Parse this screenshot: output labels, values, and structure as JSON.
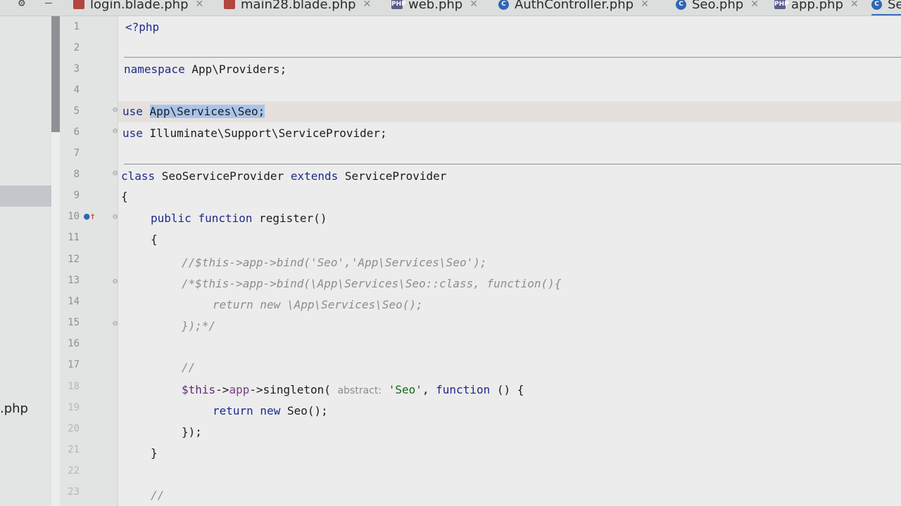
{
  "tabs": [
    {
      "label": "login.blade.php",
      "icon": "blade-file-icon"
    },
    {
      "label": "main28.blade.php",
      "icon": "blade-file-icon"
    },
    {
      "label": "web.php",
      "icon": "php-file-icon"
    },
    {
      "label": "AuthController.php",
      "icon": "class-icon"
    },
    {
      "label": "Seo.php",
      "icon": "class-icon"
    },
    {
      "label": "app.php",
      "icon": "php-file-icon"
    },
    {
      "label": "Se",
      "icon": "class-icon"
    }
  ],
  "project_panel": {
    "fragment_1": ".php"
  },
  "line_numbers": [
    "1",
    "2",
    "3",
    "4",
    "5",
    "6",
    "7",
    "8",
    "9",
    "10",
    "11",
    "12",
    "13",
    "14",
    "15",
    "16",
    "17",
    "18",
    "19",
    "20",
    "21",
    "22",
    "23"
  ],
  "code": {
    "l1_open": "<?php",
    "l3_kw": "namespace",
    "l3_rest": " App\\Providers;",
    "l5_kw": "use",
    "l5_selected": "App\\Services\\Seo;",
    "l6_kw": "use",
    "l6_rest": " Illuminate\\Support\\ServiceProvider;",
    "l8_kw": "class",
    "l8_name": " SeoServiceProvider ",
    "l8_kw2": "extends",
    "l8_parent": " ServiceProvider",
    "l9": "{",
    "l10_kw1": "public",
    "l10_kw2": "function",
    "l10_rest": " register()",
    "l11": "{",
    "l12": "//$this->app->bind('Seo','App\\Services\\Seo');",
    "l13_a": "/*$this->app->bind(\\App\\Services\\Seo::class, ",
    "l13_b": "function",
    "l13_c": "(){",
    "l14_a": "return new ",
    "l14_b": "\\App\\Services\\Seo();",
    "l15": "});*/",
    "l17": "//",
    "l18_this": "$this",
    "l18_arrow1": "->",
    "l18_app": "app",
    "l18_arrow2": "->singleton(",
    "l18_hint": "abstract:",
    "l18_str": "'Seo'",
    "l18_comma": ", ",
    "l18_fn": "function",
    "l18_end": " () {",
    "l19_kw": "return new",
    "l19_rest": " Seo();",
    "l20": "});",
    "l21": "}",
    "l23": "//"
  },
  "colors": {
    "keyword": "#1d2a8c",
    "comment": "#8a8d90",
    "string": "#116b1a",
    "selection": "#a9c4ea"
  }
}
